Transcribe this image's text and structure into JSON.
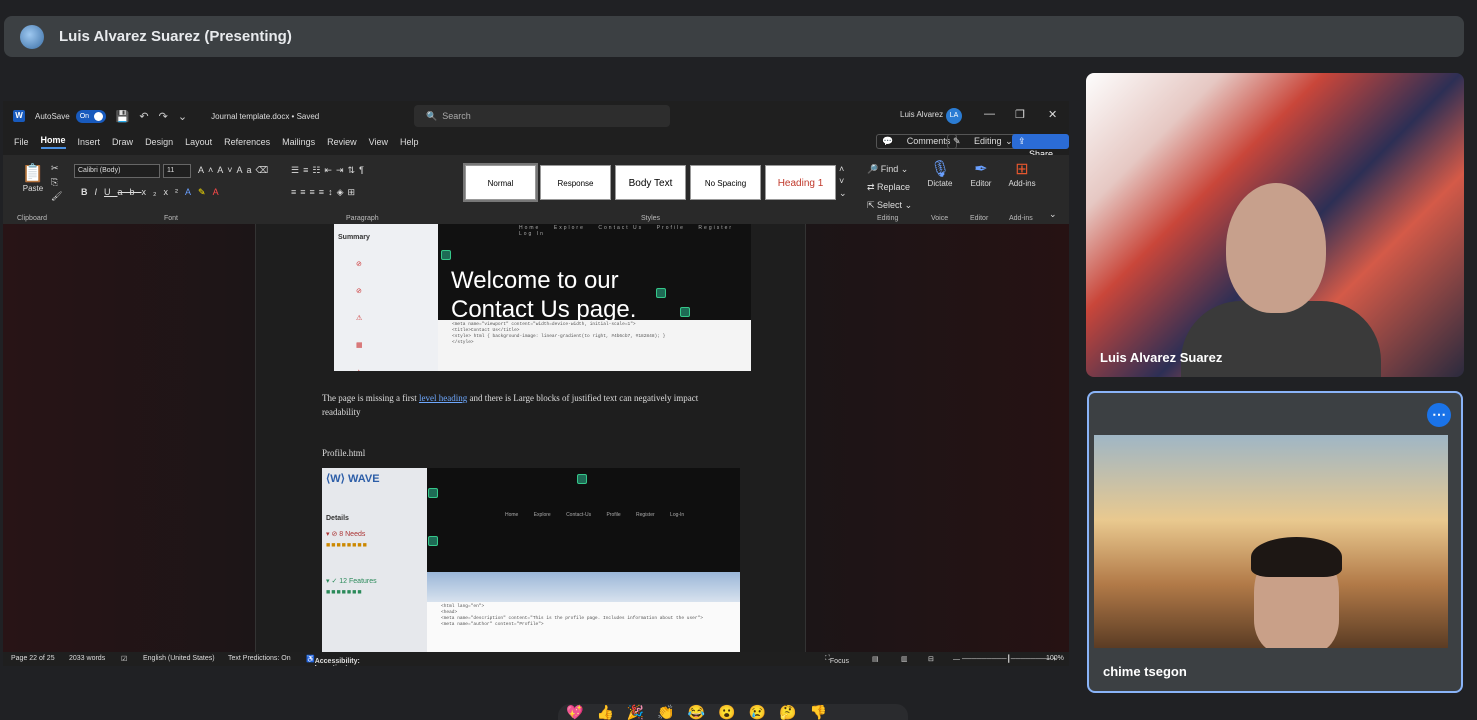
{
  "presenter_bar": {
    "title": "Luis Alvarez Suarez (Presenting)"
  },
  "word": {
    "autosave_label": "AutoSave",
    "autosave_state": "On",
    "doc_title": "Journal template.docx • Saved",
    "search_placeholder": "Search",
    "user_name": "Luis Alvarez",
    "user_initials": "LA",
    "menu": [
      "File",
      "Home",
      "Insert",
      "Draw",
      "Design",
      "Layout",
      "References",
      "Mailings",
      "Review",
      "View",
      "Help"
    ],
    "comments_label": "Comments",
    "editing_label": "Editing",
    "share_label": "Share",
    "ribbon": {
      "paste": "Paste",
      "clipboard": "Clipboard",
      "font_name": "Calibri (Body)",
      "font_size": "11",
      "font_group": "Font",
      "paragraph_group": "Paragraph",
      "styles_group": "Styles",
      "styles": [
        "Normal",
        "Response",
        "Body Text",
        "No Spacing",
        "Heading 1"
      ],
      "find": "Find",
      "replace": "Replace",
      "select": "Select",
      "editing_group": "Editing",
      "dictate": "Dictate",
      "voice_group": "Voice",
      "editor": "Editor",
      "editor_group": "Editor",
      "addins": "Add-ins",
      "addins_group": "Add-ins"
    },
    "document": {
      "shot1_summary": "Summary",
      "shot1_heading_line1": "Welcome to our",
      "shot1_heading_line2": "Contact Us page.",
      "para_before_link": "The page is missing a first ",
      "para_link": "level heading",
      "para_after_link": " and there is  Large blocks of justified text can negatively impact readability",
      "profile_title": "Profile.html",
      "shot2_logo": "WAVE",
      "shot2_details": "Details",
      "shot2_needs": "8 Needs",
      "shot2_features": "12 Features"
    },
    "status": {
      "page": "Page 22 of 25",
      "words": "2033 words",
      "language": "English (United States)",
      "predictions": "Text Predictions: On",
      "accessibility": "Accessibility: Investigate",
      "focus": "Focus",
      "zoom": "100%"
    }
  },
  "participants": [
    {
      "name": "Luis Alvarez Suarez"
    },
    {
      "name": "chime tsegon"
    }
  ],
  "reactions": [
    "💖",
    "👍",
    "🎉",
    "👏",
    "😂",
    "😮",
    "😢",
    "🤔",
    "👎"
  ]
}
